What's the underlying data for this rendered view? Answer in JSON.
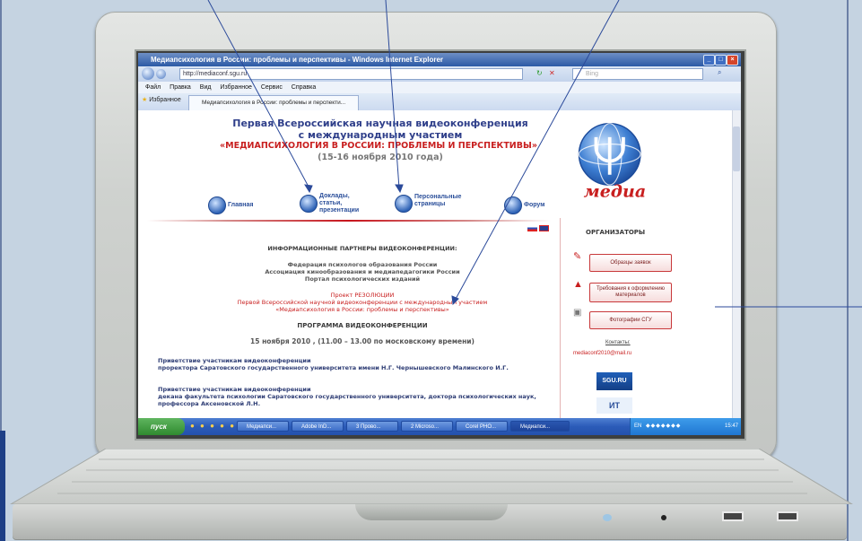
{
  "browser": {
    "window_title": "Медиапсихология в России: проблемы и перспективы - Windows Internet Explorer",
    "address": "http://mediaconf.sgu.ru",
    "search_placeholder": "Bing",
    "menu": [
      "Файл",
      "Правка",
      "Вид",
      "Избранное",
      "Сервис",
      "Справка"
    ],
    "favorites_label": "Избранное",
    "tab_label": "Медиапсихология в России: проблемы и перспекти..."
  },
  "page": {
    "title_line1": "Первая Всероссийская научная видеоконференция",
    "title_line2": "с международным участием",
    "title_line3": "«МЕДИАПСИХОЛОГИЯ В РОССИИ: ПРОБЛЕМЫ И ПЕРСПЕКТИВЫ»",
    "title_line4": "(15-16 ноября 2010 года)",
    "logo_text": "медиа",
    "nav": {
      "home": "Главная",
      "reports": "Доклады, статьи, презентации",
      "personal": "Персональные страницы",
      "forum": "Форум"
    },
    "partners_header": "ИНФОРМАЦИОННЫЕ ПАРТНЕРЫ ВИДЕОКОНФЕРЕНЦИИ:",
    "partners": [
      "Федерация психологов образования России",
      "Ассоциация кинообразования и медиапедагогики России",
      "Портал психологических изданий"
    ],
    "resolution_title": "Проект РЕЗОЛЮЦИИ",
    "resolution_line1": "Первой Всероссийской научной видеоконференции с международным участием",
    "resolution_line2": "«Медиапсихология в России: проблемы и перспективы»",
    "program_header": "ПРОГРАММА ВИДЕОКОНФЕРЕНЦИИ",
    "program_date": "15 ноября 2010 , (11.00 – 13.00 по московскому времени)",
    "greeting1_title": "Приветствие участникам видеоконференции",
    "greeting1_body": "проректора Саратовского государственного университета имени Н.Г. Чернышевского Малинского И.Г.",
    "greeting2_title": "Приветствие участникам видеоконференции",
    "greeting2_body": "декана факультета психологии Саратовского государственного университета, доктора психологических наук, профессора Аксеновской Л.Н."
  },
  "sidebar": {
    "header": "ОРГАНИЗАТОРЫ",
    "btn_samples": "Образцы заявок",
    "btn_requirements": "Требования к оформлению материалов",
    "btn_photos": "Фотографии СГУ",
    "contacts_label": "Контакты:",
    "email": "mediaconf2010@mail.ru",
    "sgu_logo": "SGU.RU",
    "second_logo": "ИТ"
  },
  "taskbar": {
    "start": "пуск",
    "tasks": [
      "Медиапси...",
      "Adobe InD...",
      "3 Прово...",
      "2 Microso...",
      "Corel PHO...",
      "Медиапси..."
    ],
    "lang": "EN",
    "clock": "15:47"
  },
  "colors": {
    "accent_red": "#c81f1f",
    "nav_blue": "#2b4f9a",
    "frame_blue": "#6b7fa6",
    "page_bg": "#c5d3e1"
  }
}
